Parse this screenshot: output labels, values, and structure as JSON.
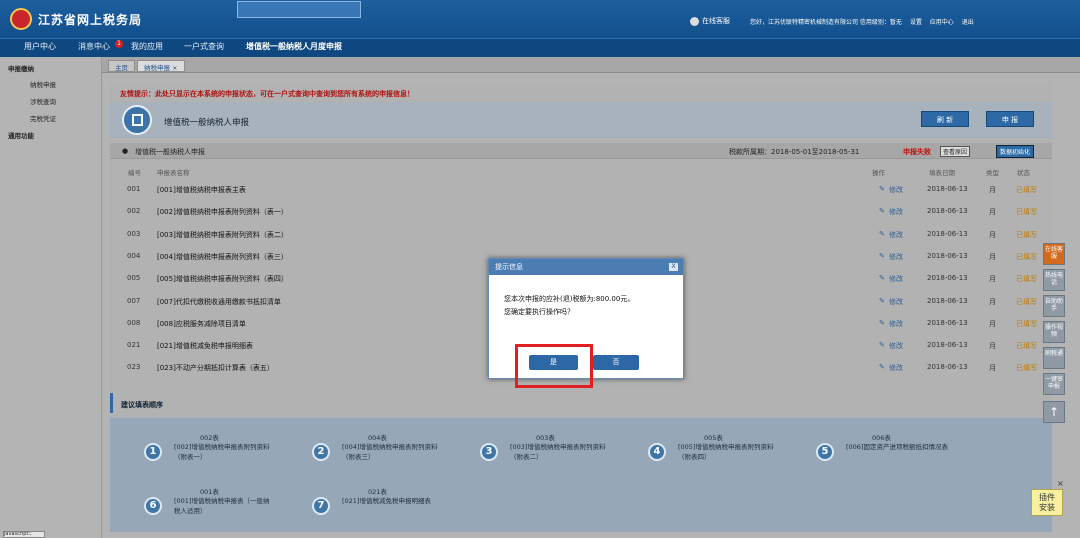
{
  "header": {
    "site_title": "江苏省网上税务局",
    "online_service": "在线客服",
    "user_company": "您好，江苏优联特精密机械制造有限公司 信用级别：暂无",
    "settings": "设置",
    "app_center": "应用中心",
    "logout": "退出"
  },
  "nav": {
    "items": [
      "用户中心",
      "消息中心",
      "我的应用",
      "一户式查询",
      "增值税一般纳税人月度申报"
    ],
    "message_badge": "1"
  },
  "sidebar": {
    "group1": "申报缴纳",
    "items": [
      "纳税申报",
      "涉税查询",
      "完税凭证"
    ],
    "group2": "通用功能"
  },
  "tabs": {
    "home": "主页",
    "current": "纳税申报 ×"
  },
  "page": {
    "tip": "友情提示：此处只显示在本系统的申报状态，可在一户式查询中查询到您所有系统的申报信息！",
    "form_title": "增值税一般纳税人申报",
    "refresh": "刷 新",
    "declare": "申 报",
    "sub_title": "增值税一般纳税人申报",
    "period": "税款所属期：2018-05-01至2018-05-31",
    "status_label": "申报失败",
    "view_reason": "查看原因",
    "init": "数据初始化"
  },
  "table": {
    "headers": [
      "编号",
      "申报表名称",
      "操作",
      "填表日期",
      "类型",
      "状态"
    ],
    "rows": [
      {
        "code": "001",
        "name": "[001]增值税纳税申报表主表",
        "op": "修改",
        "date": "2018-06-13",
        "type": "月",
        "status": "已填写"
      },
      {
        "code": "002",
        "name": "[002]增值税纳税申报表附列资料（表一）",
        "op": "修改",
        "date": "2018-06-13",
        "type": "月",
        "status": "已填写"
      },
      {
        "code": "003",
        "name": "[003]增值税纳税申报表附列资料（表二）",
        "op": "修改",
        "date": "2018-06-13",
        "type": "月",
        "status": "已填写"
      },
      {
        "code": "004",
        "name": "[004]增值税纳税申报表附列资料（表三）",
        "op": "修改",
        "date": "2018-06-13",
        "type": "月",
        "status": "已填写"
      },
      {
        "code": "005",
        "name": "[005]增值税纳税申报表附列资料（表四）",
        "op": "修改",
        "date": "2018-06-13",
        "type": "月",
        "status": "已填写"
      },
      {
        "code": "007",
        "name": "[007]代扣代缴税收通用缴款书抵扣清单",
        "op": "修改",
        "date": "2018-06-13",
        "type": "月",
        "status": "已填写"
      },
      {
        "code": "008",
        "name": "[008]应税服务减除项目清单",
        "op": "修改",
        "date": "2018-06-13",
        "type": "月",
        "status": "已填写"
      },
      {
        "code": "021",
        "name": "[021]增值税减免税申报明细表",
        "op": "修改",
        "date": "2018-06-13",
        "type": "月",
        "status": "已填写"
      },
      {
        "code": "023",
        "name": "[023]不动产分期抵扣计算表（表五）",
        "op": "修改",
        "date": "2018-06-13",
        "type": "月",
        "status": "已填写"
      }
    ]
  },
  "suggest": {
    "title": "建议填表顺序",
    "steps": [
      {
        "n": "1",
        "code": "002表",
        "name": "[002]增值税纳税申报表附列资料",
        "sub": "（附表一）"
      },
      {
        "n": "2",
        "code": "004表",
        "name": "[004]增值税纳税申报表附列资料",
        "sub": "（附表三）"
      },
      {
        "n": "3",
        "code": "003表",
        "name": "[003]增值税纳税申报表附列资料",
        "sub": "（附表二）"
      },
      {
        "n": "4",
        "code": "005表",
        "name": "[005]增值税纳税申报表附列资料",
        "sub": "（附表四）"
      },
      {
        "n": "5",
        "code": "006表",
        "name": "[006]固定资产进项税额抵扣情况表",
        "sub": ""
      },
      {
        "n": "6",
        "code": "001表",
        "name": "[001]增值税纳税申报表（一般纳",
        "sub": "税人适用）"
      },
      {
        "n": "7",
        "code": "021表",
        "name": "[021]增值税减免税申报明细表",
        "sub": ""
      }
    ]
  },
  "right_tools": [
    "在线客服",
    "热线电话",
    "自助助手",
    "操作视频",
    "刷税通",
    "一键审申报"
  ],
  "dialog": {
    "title": "提示信息",
    "message_line1": "您本次申报的应补(退)税额为:800.00元。",
    "message_line2": "您确定要执行操作吗？",
    "yes": "是",
    "no": "否"
  },
  "plugin": {
    "line1": "插件",
    "line2": "安装"
  },
  "bottom_left": "javascript:;"
}
